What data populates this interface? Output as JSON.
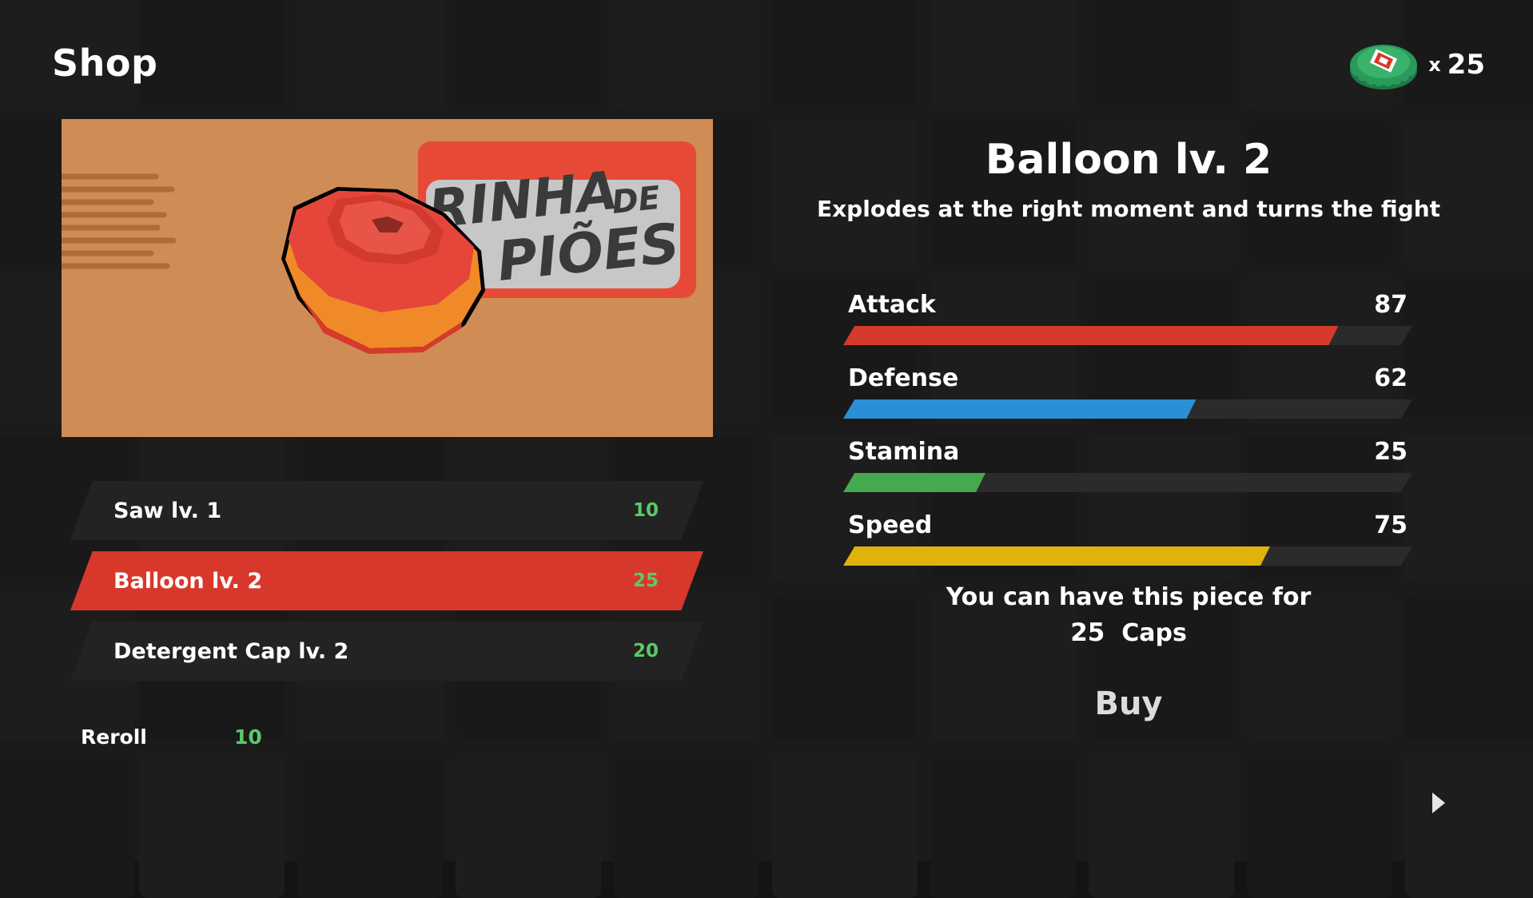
{
  "header": {
    "title": "Shop",
    "currency_prefix": "x",
    "currency_amount": "25",
    "currency_icon": "bottle-cap-icon"
  },
  "preview": {
    "banner_line1": "RINHA",
    "banner_line2": "DE",
    "banner_line3": "PIÕES",
    "background_color": "#cf8c55"
  },
  "items": [
    {
      "name": "Saw lv. 1",
      "price": "10",
      "selected": false
    },
    {
      "name": "Balloon lv. 2",
      "price": "25",
      "selected": true
    },
    {
      "name": "Detergent Cap lv. 2",
      "price": "20",
      "selected": false
    }
  ],
  "reroll": {
    "label": "Reroll",
    "price": "10"
  },
  "piece": {
    "title": "Balloon lv. 2",
    "description": "Explodes at the right moment and turns the fight"
  },
  "stats": [
    {
      "label": "Attack",
      "value": "87",
      "percent": 87,
      "color": "#d63a2c"
    },
    {
      "label": "Defense",
      "value": "62",
      "percent": 62,
      "color": "#2a8fd4"
    },
    {
      "label": "Stamina",
      "value": "25",
      "percent": 25,
      "color": "#46a84f"
    },
    {
      "label": "Speed",
      "value": "75",
      "percent": 75,
      "color": "#e0b20c"
    }
  ],
  "offer": {
    "line1": "You can have this piece for",
    "price": "25",
    "unit": "Caps"
  },
  "buy_label": "Buy",
  "next_icon": "play-arrow-icon"
}
